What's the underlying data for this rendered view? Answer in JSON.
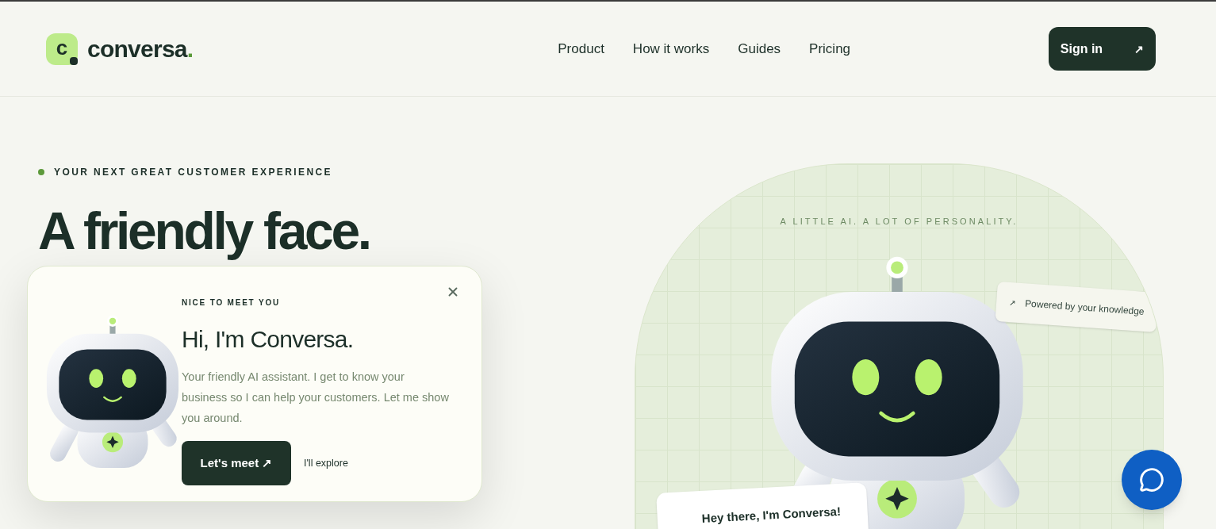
{
  "header": {
    "logo": {
      "mark": "c",
      "wordmark": "conversa",
      "dot": "."
    },
    "nav": [
      {
        "label": "Product"
      },
      {
        "label": "How it works"
      },
      {
        "label": "Guides"
      },
      {
        "label": "Pricing"
      }
    ],
    "sign_in": {
      "label": "Sign in",
      "arrow": "↗"
    }
  },
  "hero": {
    "eyebrow": "YOUR NEXT GREAT CUSTOMER EXPERIENCE",
    "headline": "A friendly face."
  },
  "showcase": {
    "tagline": "A LITTLE AI. A LOT OF PERSONALITY.",
    "badge": {
      "arrow": "↗",
      "text": "Powered by your knowledge"
    },
    "greeting": "Hey there, I'm Conversa!"
  },
  "popup": {
    "eyebrow": "NICE TO MEET YOU",
    "title": "Hi, I'm Conversa.",
    "body": "Your friendly AI assistant. I get to know your business so I can help your customers. Let me show you around.",
    "primary": "Let's meet ↗",
    "secondary": "I'll explore"
  }
}
